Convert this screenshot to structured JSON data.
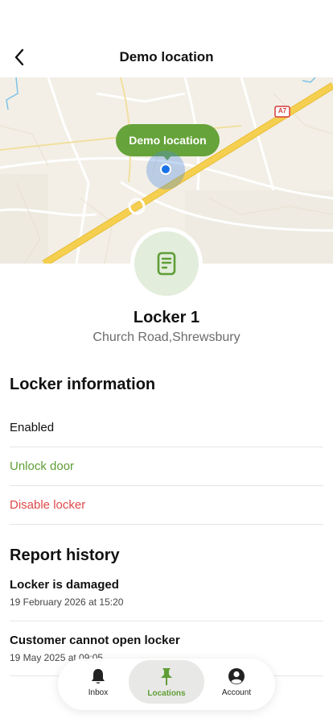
{
  "header": {
    "title": "Demo location",
    "back_icon": "chevron-left-icon"
  },
  "map": {
    "pill_label": "Demo location",
    "road_shield": "A7",
    "colors": {
      "background": "#f3efe6",
      "major_road": "#f5cf4f",
      "minor_road": "#f1dfa0",
      "water": "#7ec3e8",
      "pin": "#1a73e8",
      "pill": "#66a33a"
    }
  },
  "locker": {
    "icon": "locker-icon",
    "name": "Locker 1",
    "address": "Church Road,Shrewsbury"
  },
  "locker_information": {
    "title": "Locker information",
    "rows": [
      {
        "label": "Enabled",
        "color": "#111111"
      },
      {
        "label": "Unlock door",
        "color": "#5f9e36"
      },
      {
        "label": "Disable locker",
        "color": "#e04848"
      }
    ]
  },
  "report_history": {
    "title": "Report history",
    "items": [
      {
        "title": "Locker is damaged",
        "date": "19 February 2026 at 15:20"
      },
      {
        "title": "Customer cannot open locker",
        "date": "19 May 2025 at 09:05"
      }
    ]
  },
  "tabbar": {
    "active": "Locations",
    "tabs": [
      {
        "label": "Inbox",
        "icon": "bell-icon"
      },
      {
        "label": "Locations",
        "icon": "pin-icon"
      },
      {
        "label": "Account",
        "icon": "account-icon"
      }
    ]
  }
}
